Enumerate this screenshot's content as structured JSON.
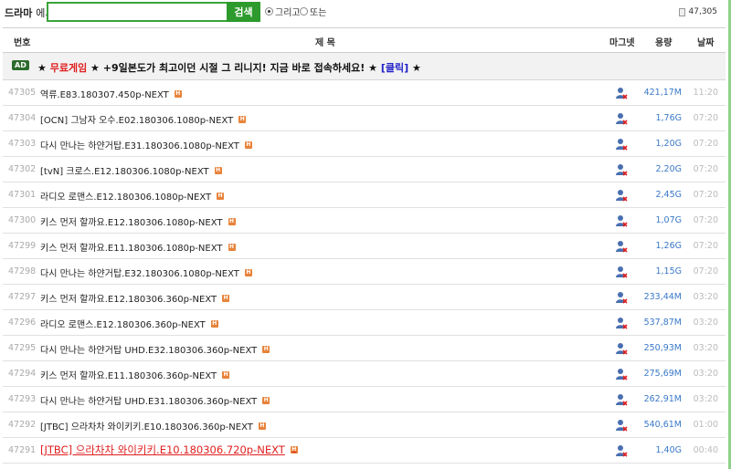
{
  "search": {
    "label": "드라마",
    "label_suffix": "에서",
    "value": "",
    "button": "검색",
    "option_and": "그리고",
    "option_or": "또는",
    "total": "47,305"
  },
  "table": {
    "headers": {
      "num": "번호",
      "title": "제 목",
      "magnet": "마그넷",
      "size": "용량",
      "date": "날짜"
    },
    "ad": {
      "badge": "AD",
      "star1": "★",
      "free": "무료게임",
      "star2": "★",
      "text": "+9일본도가 최고이던 시절 그 리니지! 지금 바로 접속하세요!",
      "star3": "★",
      "link": "[클릭]",
      "star4": "★"
    },
    "rows": [
      {
        "num": "47305",
        "title": "역류.E83.180307.450p-NEXT",
        "size": "421,17M",
        "date": "11:20"
      },
      {
        "num": "47304",
        "title": "[OCN] 그남자 오수.E02.180306.1080p-NEXT",
        "size": "1,76G",
        "date": "07:20"
      },
      {
        "num": "47303",
        "title": "다시 만나는 하얀거탑.E31.180306.1080p-NEXT",
        "size": "1,20G",
        "date": "07:20"
      },
      {
        "num": "47302",
        "title": "[tvN] 크로스.E12.180306.1080p-NEXT",
        "size": "2,20G",
        "date": "07:20"
      },
      {
        "num": "47301",
        "title": "라디오 로맨스.E12.180306.1080p-NEXT",
        "size": "2,45G",
        "date": "07:20"
      },
      {
        "num": "47300",
        "title": "키스 먼저 할까요.E12.180306.1080p-NEXT",
        "size": "1,07G",
        "date": "07:20"
      },
      {
        "num": "47299",
        "title": "키스 먼저 할까요.E11.180306.1080p-NEXT",
        "size": "1,26G",
        "date": "07:20"
      },
      {
        "num": "47298",
        "title": "다시 만나는 하얀거탑.E32.180306.1080p-NEXT",
        "size": "1,15G",
        "date": "07:20"
      },
      {
        "num": "47297",
        "title": "키스 먼저 할까요.E12.180306.360p-NEXT",
        "size": "233,44M",
        "date": "03:20"
      },
      {
        "num": "47296",
        "title": "라디오 로맨스.E12.180306.360p-NEXT",
        "size": "537,87M",
        "date": "03:20"
      },
      {
        "num": "47295",
        "title": "다시 만나는 하얀거탑 UHD.E32.180306.360p-NEXT",
        "size": "250,93M",
        "date": "03:20"
      },
      {
        "num": "47294",
        "title": "키스 먼저 할까요.E11.180306.360p-NEXT",
        "size": "275,69M",
        "date": "03:20"
      },
      {
        "num": "47293",
        "title": "다시 만나는 하얀거탑 UHD.E31.180306.360p-NEXT",
        "size": "262,91M",
        "date": "03:20"
      },
      {
        "num": "47292",
        "title": "[JTBC] 으라차차 와이키키.E10.180306.360p-NEXT",
        "size": "540,61M",
        "date": "01:00"
      },
      {
        "num": "47291",
        "title": "[JTBC] 으라차차 와이키키.E10.180306.720p-NEXT",
        "size": "1,40G",
        "date": "00:40"
      }
    ]
  },
  "colors": {
    "accent_green": "#2c9a2c",
    "size_blue": "#3a79c8",
    "highlight_red": "#e02020"
  }
}
